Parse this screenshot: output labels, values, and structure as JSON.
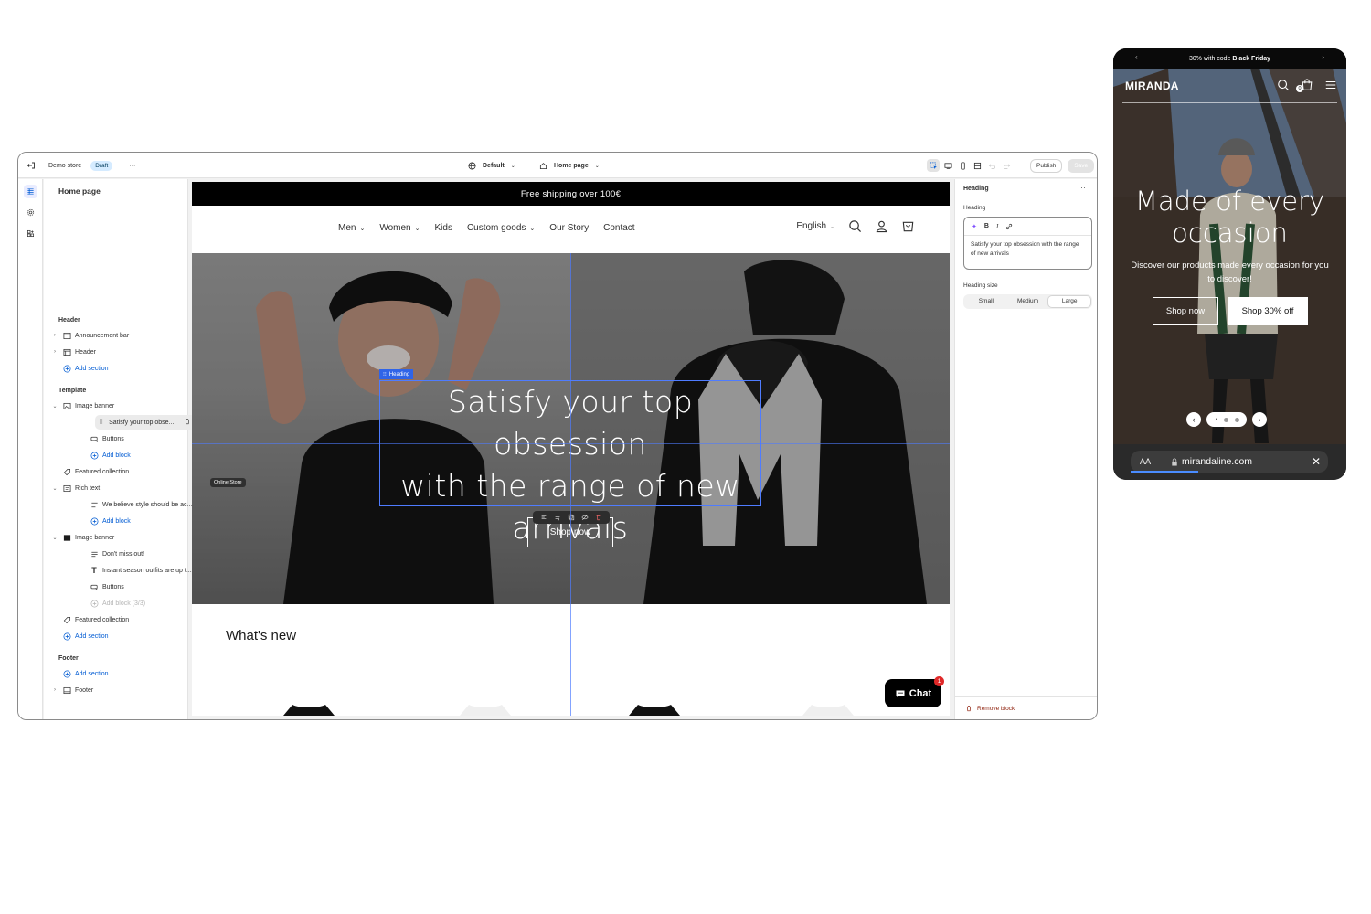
{
  "topbar": {
    "store_name": "Demo store",
    "status_badge": "Draft",
    "more": "···",
    "theme_select": "Default",
    "page_select": "Home page",
    "publish_label": "Publish",
    "save_label": "Save"
  },
  "left_panel": {
    "title": "Home page",
    "header_group": "Header",
    "header_items": [
      "Announcement bar",
      "Header"
    ],
    "add_section": "Add section",
    "template_group": "Template",
    "image_banner_1": "Image banner",
    "ib1_blocks": [
      "Satisfy your top obse...",
      "Buttons"
    ],
    "add_block": "Add block",
    "featured_collection": "Featured collection",
    "rich_text": "Rich text",
    "rich_text_blocks": [
      "We believe style should be ac..."
    ],
    "image_banner_2": "Image banner",
    "ib2_blocks": [
      "Don't miss out!",
      "Instant season outfits are up t...",
      "Buttons"
    ],
    "add_block_disabled": "Add block (3/3)",
    "footer_group": "Footer",
    "footer_item": "Footer"
  },
  "preview": {
    "announcement": "Free shipping over 100€",
    "nav": [
      "Men",
      "Women",
      "Kids",
      "Custom goods",
      "Our Story",
      "Contact"
    ],
    "nav_dropdown": [
      true,
      true,
      false,
      true,
      false,
      false
    ],
    "language": "English",
    "heading_tag": "Heading",
    "hero_heading_lines": [
      "Satisfy your top obsession",
      "with the range of new",
      "arrivals"
    ],
    "hero_button": "Shop now",
    "online_store_tag": "Online Store",
    "whats_new": "What's new",
    "chat_label": "Chat",
    "chat_badge": "1"
  },
  "right_panel": {
    "title": "Heading",
    "more": "···",
    "field_label": "Heading",
    "rte_text": "Satisfy your top obsession with the range of new arrivals",
    "size_label": "Heading size",
    "size_options": [
      "Small",
      "Medium",
      "Large"
    ],
    "size_selected": "Large",
    "remove_block": "Remove block"
  },
  "phone": {
    "announcement_prefix": "30% with code ",
    "announcement_bold": "Black Friday",
    "logo": "MIRANDA",
    "cart_count": "0",
    "hero_heading_lines": [
      "Made of every",
      "occasion"
    ],
    "hero_sub": "Discover our products made every occasion for you to discover!",
    "btn_shop_now": "Shop now",
    "btn_shop_off": "Shop 30% off",
    "url_aa": "AA",
    "url": "mirandaline.com",
    "url_close": "✕"
  },
  "colors": {
    "accent_blue": "#005bd3",
    "selection_blue": "#4f7cff",
    "danger": "#8e1f0b",
    "chat_badge": "#e02929"
  }
}
